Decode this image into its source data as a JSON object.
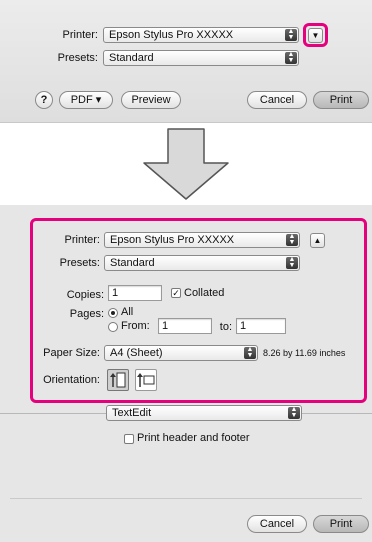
{
  "top_dialog": {
    "printer_label": "Printer:",
    "printer_value": "Epson Stylus Pro XXXXX",
    "presets_label": "Presets:",
    "presets_value": "Standard",
    "help_label": "?",
    "pdf_label": "PDF ▾",
    "preview_label": "Preview",
    "cancel_label": "Cancel",
    "print_label": "Print"
  },
  "bottom_dialog": {
    "printer_label": "Printer:",
    "printer_value": "Epson Stylus Pro XXXXX",
    "presets_label": "Presets:",
    "presets_value": "Standard",
    "copies_label": "Copies:",
    "copies_value": "1",
    "collated_label": "Collated",
    "pages_label": "Pages:",
    "all_label": "All",
    "from_label": "From:",
    "from_value": "1",
    "to_label": "to:",
    "to_value": "1",
    "paper_size_label": "Paper Size:",
    "paper_size_value": "A4 (Sheet)",
    "paper_size_dims": "8.26 by 11.69 inches",
    "orientation_label": "Orientation:",
    "app_popup_value": "TextEdit",
    "header_footer_label": "Print header and footer",
    "cancel_label": "Cancel",
    "print_label": "Print"
  },
  "colors": {
    "highlight": "#e5007e"
  }
}
